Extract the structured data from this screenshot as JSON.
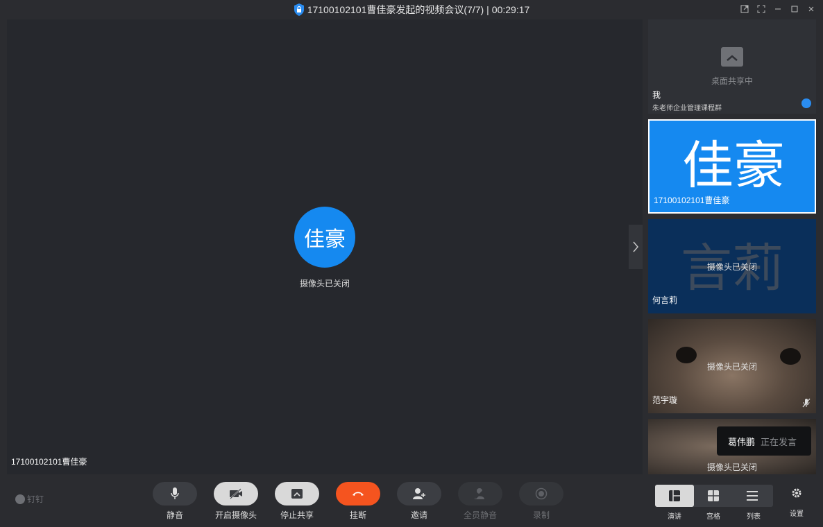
{
  "titlebar": {
    "title": "17100102101曹佳豪发起的视频会议(7/7)",
    "separator": "|",
    "timer": "00:29:17"
  },
  "stage": {
    "avatar_text": "佳豪",
    "camera_status": "摄像头已关闭",
    "speaker_name": "17100102101曹佳豪"
  },
  "side": {
    "tiles": [
      {
        "name": "我",
        "subtitle": "朱老师企业管理课程群",
        "status": "桌面共享中"
      },
      {
        "name": "17100102101曹佳豪",
        "avatar_text": "佳豪"
      },
      {
        "name": "何言莉",
        "avatar_text": "言莉",
        "status": "摄像头已关闭"
      },
      {
        "name": "范宇璇",
        "status": "摄像头已关闭"
      },
      {
        "status": "摄像头已关闭"
      }
    ],
    "speaking_toast": {
      "name": "葛伟鹏",
      "state": "正在发言"
    }
  },
  "toolbar": {
    "brand": "钉钉",
    "buttons": [
      {
        "label": "静音",
        "icon": "microphone-icon"
      },
      {
        "label": "开启摄像头",
        "icon": "camera-off-icon"
      },
      {
        "label": "停止共享",
        "icon": "stop-share-icon"
      },
      {
        "label": "挂断",
        "icon": "hangup-icon"
      },
      {
        "label": "邀请",
        "icon": "invite-icon"
      },
      {
        "label": "全员静音",
        "icon": "mute-all-icon"
      },
      {
        "label": "录制",
        "icon": "record-icon"
      }
    ],
    "views": [
      {
        "label": "演讲",
        "icon": "speaker-view-icon"
      },
      {
        "label": "宫格",
        "icon": "grid-view-icon"
      },
      {
        "label": "列表",
        "icon": "list-view-icon"
      }
    ],
    "settings_label": "设置"
  },
  "colors": {
    "accent_blue": "#1589f0",
    "hangup_red": "#f5541f",
    "background": "#2b2c30"
  }
}
